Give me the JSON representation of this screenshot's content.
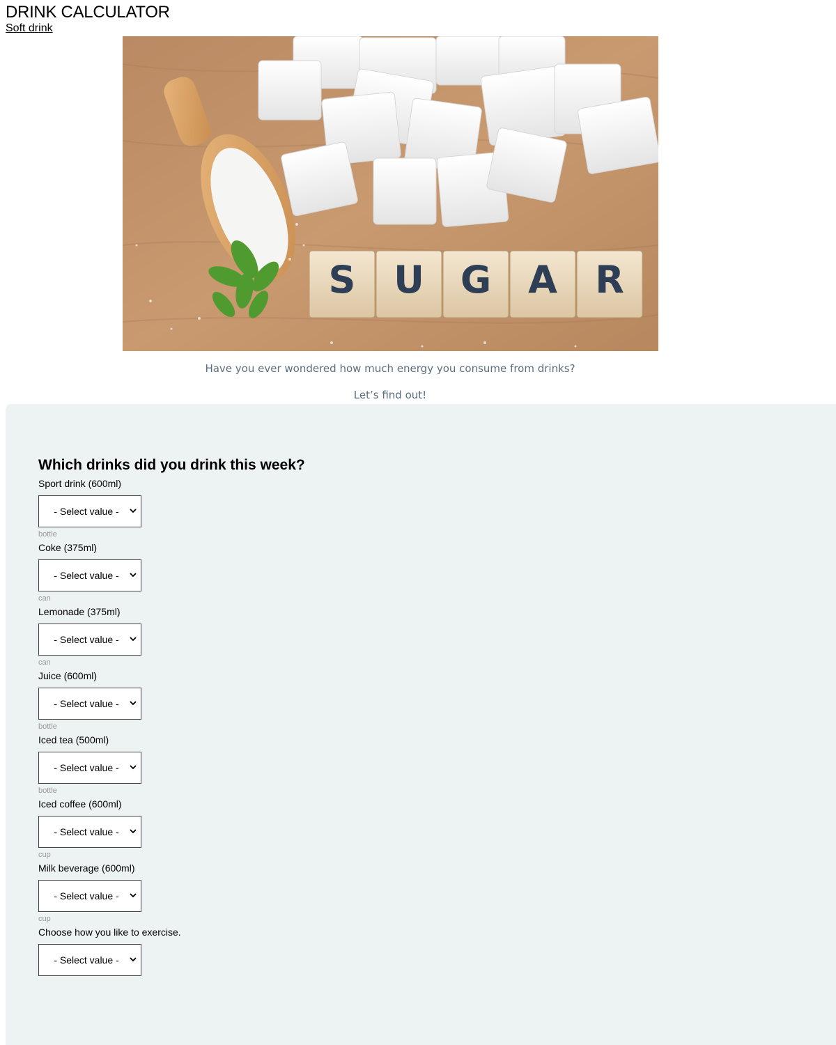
{
  "header": {
    "title": "DRINK CALCULATOR",
    "nav_link": "Soft drink"
  },
  "hero": {
    "word_tiles": [
      "S",
      "U",
      "G",
      "A",
      "R"
    ]
  },
  "intro": {
    "question": "Have you ever wondered how much energy you consume from drinks?",
    "cta": "Let’s find out!"
  },
  "form": {
    "title": "Which drinks did you drink this week?",
    "fields": [
      {
        "label": "Sport drink (600ml)",
        "value": "- Select value -",
        "unit": "bottle"
      },
      {
        "label": "Coke (375ml)",
        "value": "- Select value -",
        "unit": "can"
      },
      {
        "label": "Lemonade (375ml)",
        "value": "- Select value -",
        "unit": "can"
      },
      {
        "label": "Juice (600ml)",
        "value": "- Select value -",
        "unit": "bottle"
      },
      {
        "label": "Iced tea (500ml)",
        "value": "- Select value -",
        "unit": "bottle"
      },
      {
        "label": "Iced coffee (600ml)",
        "value": "- Select value -",
        "unit": "cup"
      },
      {
        "label": "Milk beverage (600ml)",
        "value": "- Select value -",
        "unit": "cup"
      },
      {
        "label": "Choose how you like to exercise.",
        "value": "- Select value -",
        "unit": ""
      }
    ]
  },
  "colors": {
    "panel_bg": "#edf3f3",
    "intro_text": "#5b6f7f",
    "tile_letter": "#2e3e55"
  }
}
